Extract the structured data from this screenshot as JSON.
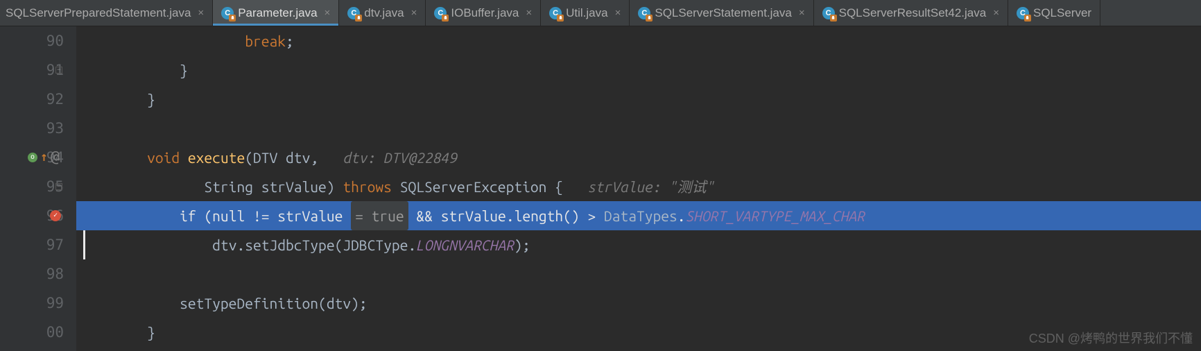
{
  "tabs": [
    {
      "label": "SQLServerPreparedStatement.java",
      "icon": false,
      "close": true,
      "active": false
    },
    {
      "label": "Parameter.java",
      "icon": true,
      "close": true,
      "active": true
    },
    {
      "label": "dtv.java",
      "icon": true,
      "close": true,
      "active": false
    },
    {
      "label": "IOBuffer.java",
      "icon": true,
      "close": true,
      "active": false
    },
    {
      "label": "Util.java",
      "icon": true,
      "close": true,
      "active": false
    },
    {
      "label": "SQLServerStatement.java",
      "icon": true,
      "close": true,
      "active": false
    },
    {
      "label": "SQLServerResultSet42.java",
      "icon": true,
      "close": true,
      "active": false
    },
    {
      "label": "SQLServer",
      "icon": true,
      "close": false,
      "active": false
    }
  ],
  "lines": {
    "90": {
      "indent": "                    ",
      "tokens": [
        [
          "kw",
          "break"
        ],
        [
          "op",
          ";"
        ]
      ]
    },
    "91": {
      "indent": "            ",
      "tokens": [
        [
          "op",
          "}"
        ]
      ]
    },
    "92": {
      "indent": "        ",
      "tokens": [
        [
          "op",
          "}"
        ]
      ]
    },
    "93": {
      "indent": "",
      "tokens": []
    },
    "94": {
      "indent": "        ",
      "tokens": [
        [
          "kw",
          "void "
        ],
        [
          "fn",
          "execute"
        ],
        [
          "op",
          "("
        ],
        [
          "ty",
          "DTV "
        ],
        [
          "id",
          "dtv"
        ],
        [
          "op",
          ",   "
        ],
        [
          "hint",
          "dtv: DTV@22849"
        ]
      ]
    },
    "95": {
      "indent": "               ",
      "tokens": [
        [
          "ty",
          "String "
        ],
        [
          "id",
          "strValue"
        ],
        [
          "op",
          ") "
        ],
        [
          "kw",
          "throws "
        ],
        [
          "ty",
          "SQLServerException "
        ],
        [
          "op",
          "{   "
        ],
        [
          "hint",
          "strValue: \"测试\""
        ]
      ]
    },
    "96": {
      "indent": "            ",
      "tokens": [
        [
          "kw",
          "if "
        ],
        [
          "op",
          "("
        ],
        [
          "kw",
          "null "
        ],
        [
          "op",
          "!= "
        ],
        [
          "id",
          "strValue "
        ],
        [
          "hintbox",
          "= true"
        ],
        [
          "op",
          " && "
        ],
        [
          "id",
          "strValue"
        ],
        [
          "op",
          "."
        ],
        [
          "id",
          "length"
        ],
        [
          "op",
          "() > "
        ],
        [
          "ty",
          "DataTypes"
        ],
        [
          "op",
          "."
        ],
        [
          "const",
          "SHORT_VARTYPE_MAX_CHAR"
        ]
      ]
    },
    "97": {
      "indent": "                ",
      "tokens": [
        [
          "id",
          "dtv"
        ],
        [
          "op",
          "."
        ],
        [
          "id",
          "setJdbcType"
        ],
        [
          "op",
          "("
        ],
        [
          "ty",
          "JDBCType"
        ],
        [
          "op",
          "."
        ],
        [
          "const",
          "LONGNVARCHAR"
        ],
        [
          "op",
          ");"
        ]
      ]
    },
    "98": {
      "indent": "",
      "tokens": []
    },
    "99": {
      "indent": "            ",
      "tokens": [
        [
          "id",
          "setTypeDefinition"
        ],
        [
          "op",
          "("
        ],
        [
          "id",
          "dtv"
        ],
        [
          "op",
          ");"
        ]
      ]
    },
    "00": {
      "indent": "        ",
      "tokens": [
        [
          "op",
          "}"
        ]
      ]
    }
  },
  "line_order": [
    "90",
    "91",
    "92",
    "93",
    "94",
    "95",
    "96",
    "97",
    "98",
    "99",
    "00"
  ],
  "highlight_line": "96",
  "gutter": {
    "folds": [
      "91",
      "95"
    ],
    "override_line": "94",
    "breakpoint_line": "96"
  },
  "watermark": "CSDN @烤鸭的世界我们不懂",
  "glyphs": {
    "close": "×",
    "C": "C",
    "fold": "−",
    "arrow": "↑",
    "at": "@"
  }
}
